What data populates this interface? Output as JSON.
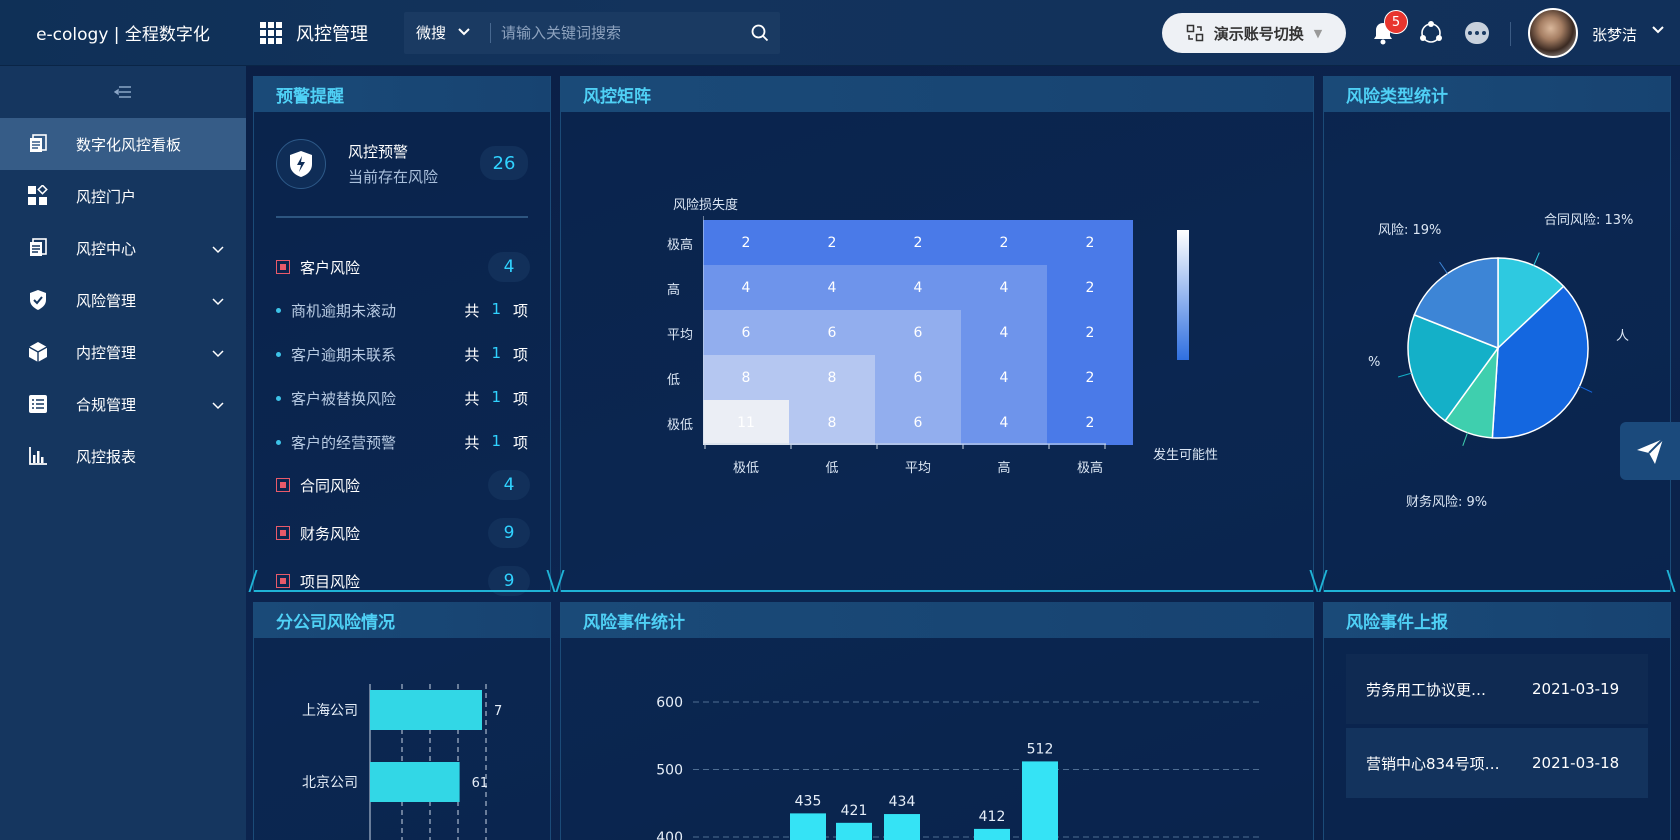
{
  "header": {
    "logo": "e-cology | 全程数字化",
    "module_title": "风控管理",
    "search_scope": "微搜",
    "search_placeholder": "请输入关键词搜索",
    "switch_account_label": "演示账号切换",
    "notification_count": "5",
    "user_name": "张梦洁"
  },
  "sidebar": {
    "items": [
      {
        "label": "数字化风控看板",
        "icon": "board-icon",
        "active": true
      },
      {
        "label": "风控门户",
        "icon": "portal-icon"
      },
      {
        "label": "风控中心",
        "icon": "document-icon",
        "expandable": true
      },
      {
        "label": "风险管理",
        "icon": "shield-icon",
        "expandable": true
      },
      {
        "label": "内控管理",
        "icon": "cube-icon",
        "expandable": true
      },
      {
        "label": "合规管理",
        "icon": "list-icon",
        "expandable": true
      },
      {
        "label": "风控报表",
        "icon": "bar-chart-icon"
      }
    ]
  },
  "alerts": {
    "title": "预警提醒",
    "card_title": "风控预警",
    "card_subtitle": "当前存在风险",
    "card_count": "26",
    "groups": [
      {
        "label": "客户风险",
        "count": "4",
        "items": [
          {
            "label": "商机逾期未滚动",
            "prefix": "共",
            "count": "1",
            "suffix": "项"
          },
          {
            "label": "客户逾期未联系",
            "prefix": "共",
            "count": "1",
            "suffix": "项"
          },
          {
            "label": "客户被替换风险",
            "prefix": "共",
            "count": "1",
            "suffix": "项"
          },
          {
            "label": "客户的经营预警",
            "prefix": "共",
            "count": "1",
            "suffix": "项"
          }
        ]
      },
      {
        "label": "合同风险",
        "count": "4"
      },
      {
        "label": "财务风险",
        "count": "9"
      },
      {
        "label": "项目风险",
        "count": "9"
      }
    ]
  },
  "matrix": {
    "title": "风控矩阵",
    "y_axis_label": "风险损失度",
    "x_axis_label": "发生可能性",
    "rows": [
      "极高",
      "高",
      "平均",
      "低",
      "极低"
    ],
    "cols": [
      "极低",
      "低",
      "平均",
      "高",
      "极高"
    ],
    "values": [
      [
        2,
        2,
        2,
        2,
        2
      ],
      [
        4,
        4,
        4,
        4,
        2
      ],
      [
        6,
        6,
        6,
        4,
        2
      ],
      [
        8,
        8,
        6,
        4,
        2
      ],
      [
        11,
        8,
        6,
        4,
        2
      ]
    ]
  },
  "risk_types": {
    "title": "风险类型统计",
    "slices": [
      {
        "label": "合同风险: 13%",
        "value": 13,
        "color": "#2ec9e0"
      },
      {
        "label": "人",
        "value": 38,
        "color": "#1467e0"
      },
      {
        "label": "财务风险: 9%",
        "value": 9,
        "color": "#3fcfae"
      },
      {
        "label": "%",
        "value": 21,
        "color": "#14b0c8"
      },
      {
        "label": "风险: 19%",
        "value": 19,
        "color": "#3d85d6"
      }
    ]
  },
  "branch": {
    "title": "分公司风险情况",
    "bars": [
      {
        "label": "上海公司",
        "value": "7",
        "v": 7
      },
      {
        "label": "北京公司",
        "value": "61",
        "v": 5.6
      }
    ]
  },
  "events": {
    "title": "风险事件统计",
    "y_ticks": [
      "600",
      "500",
      "400"
    ],
    "bars": [
      {
        "value": "435",
        "v": 435
      },
      {
        "value": "421",
        "v": 421
      },
      {
        "value": "434",
        "v": 434
      },
      {
        "value": "412",
        "v": 412
      },
      {
        "value": "512",
        "v": 512
      }
    ]
  },
  "report": {
    "title": "风险事件上报",
    "items": [
      {
        "title": "劳务用工协议更…",
        "date": "2021-03-19"
      },
      {
        "title": "营销中心834号项…",
        "date": "2021-03-18"
      }
    ]
  }
}
